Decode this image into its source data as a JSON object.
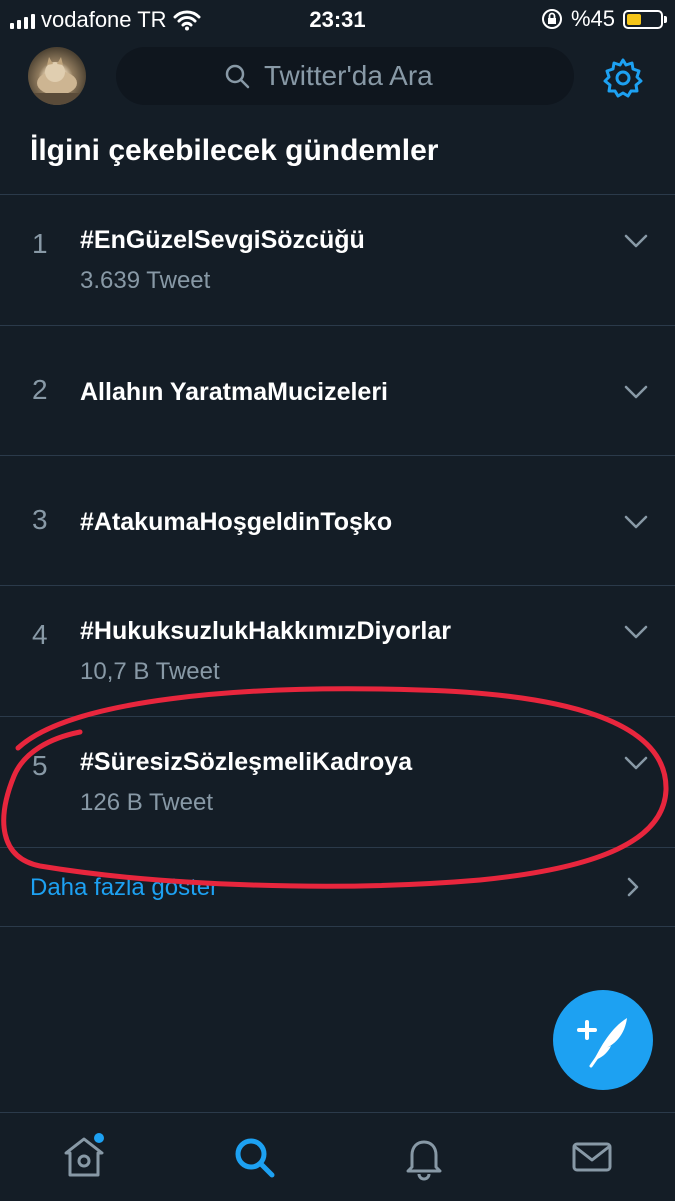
{
  "status_bar": {
    "carrier": "vodafone TR",
    "time": "23:31",
    "battery_percent": "%45",
    "battery_level": 0.45
  },
  "header": {
    "search_placeholder": "Twitter'da Ara",
    "settings_icon": "gear-icon"
  },
  "section": {
    "title": "İlgini çekebilecek gündemler"
  },
  "trends": [
    {
      "rank": "1",
      "name": "#EnGüzelSevgiSözcüğü",
      "count": "3.639 Tweet"
    },
    {
      "rank": "2",
      "name": "Allahın YaratmaMucizeleri",
      "count": ""
    },
    {
      "rank": "3",
      "name": "#AtakumaHoşgeldinToşko",
      "count": ""
    },
    {
      "rank": "4",
      "name": "#HukuksuzlukHakkımızDiyorlar",
      "count": "10,7 B Tweet"
    },
    {
      "rank": "5",
      "name": "#SüresizSözleşmeliKadroya",
      "count": "126 B Tweet"
    }
  ],
  "show_more": {
    "label": "Daha fazla göster"
  },
  "tabbar": {
    "items": [
      "home-icon",
      "search-icon",
      "notifications-icon",
      "messages-icon"
    ],
    "active": "search-icon"
  },
  "colors": {
    "background": "#141d26",
    "accent": "#1da1f2",
    "secondary_text": "#8899a6",
    "annotation": "#e8263d"
  }
}
